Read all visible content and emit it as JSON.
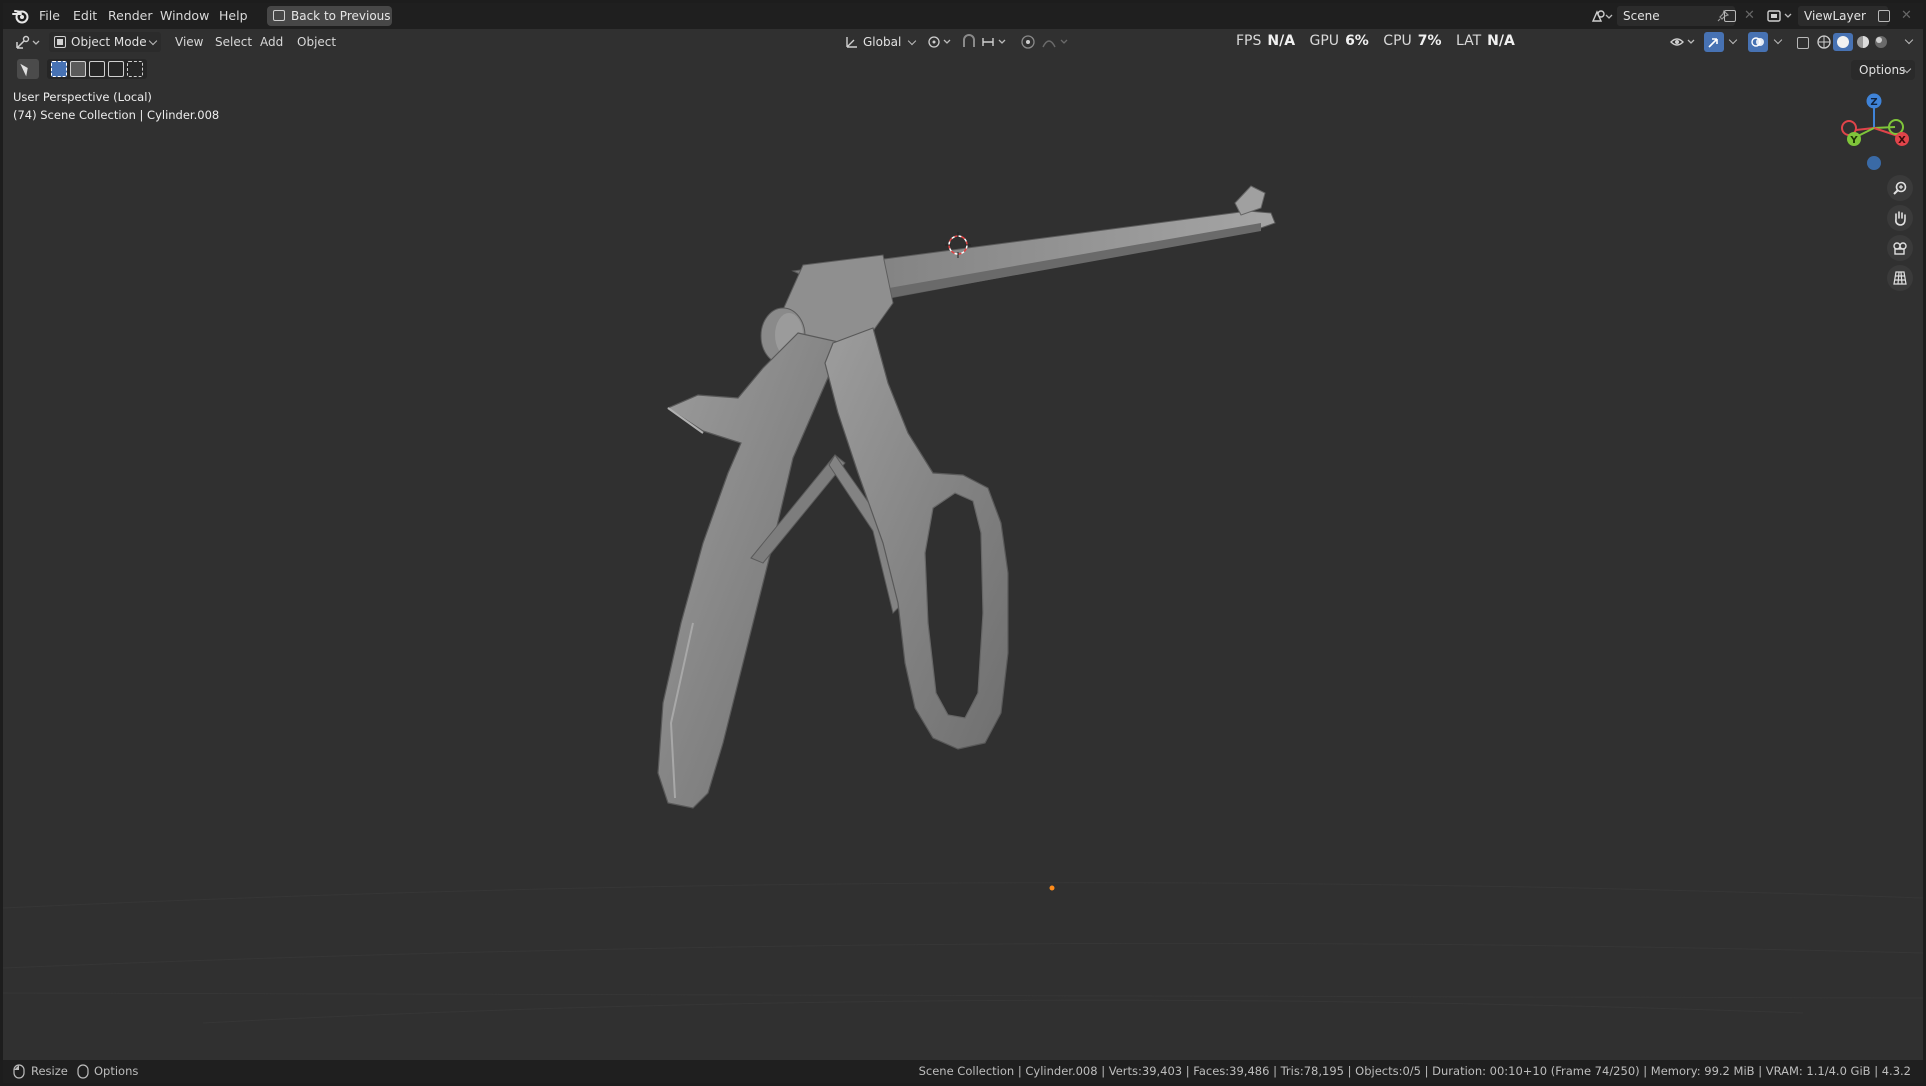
{
  "menubar": {
    "items": [
      "File",
      "Edit",
      "Render",
      "Window",
      "Help"
    ],
    "back_button": "Back to Previous",
    "scene_name": "Scene",
    "view_layer": "ViewLayer"
  },
  "header": {
    "mode": "Object Mode",
    "menus": [
      "View",
      "Select",
      "Add",
      "Object"
    ],
    "transform_orientation": "Global",
    "options_label": "Options"
  },
  "hud": {
    "fps_label": "FPS",
    "fps_value": "N/A",
    "gpu_label": "GPU",
    "gpu_value": "6%",
    "cpu_label": "CPU",
    "cpu_value": "7%",
    "lat_label": "LAT",
    "lat_value": "N/A"
  },
  "viewport": {
    "view_name": "User Perspective (Local)",
    "collection_info": "(74) Scene Collection | Cylinder.008"
  },
  "gizmo": {
    "axes": [
      "Z",
      "Y",
      "X"
    ],
    "colors": {
      "x": "#e0444a",
      "y": "#7fc53a",
      "z": "#3f83d8"
    }
  },
  "statusbar": {
    "left_items": [
      "Resize",
      "Options"
    ],
    "stats": "Scene Collection | Cylinder.008 | Verts:39,403 | Faces:39,486 | Tris:78,195 | Objects:0/5 | Duration: 00:10+10 (Frame 74/250) | Memory: 99.2 MiB | VRAM: 1.1/4.0 GiB | 4.3.2"
  },
  "colors": {
    "viewport_bg": "#303030",
    "bar_bg": "#1f1f1f",
    "accent_blue": "#4772b3",
    "model_gray": "#8a8a8a",
    "origin_orange": "#ff8c1a"
  }
}
